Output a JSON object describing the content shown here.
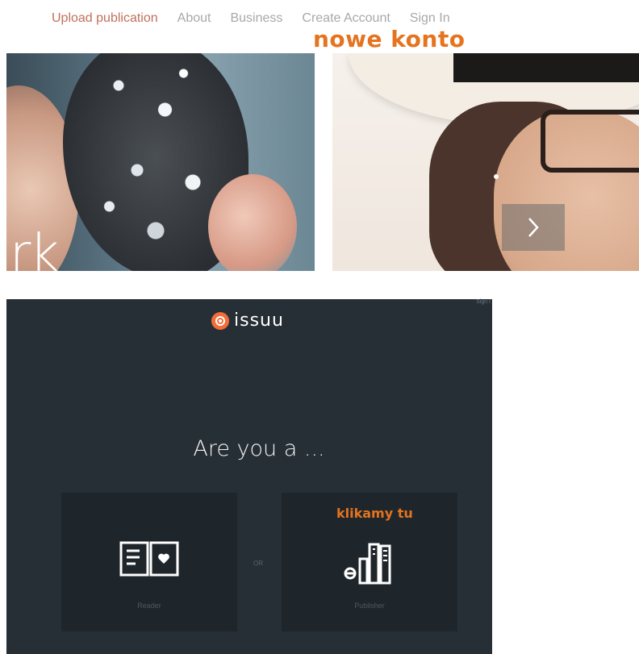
{
  "nav": {
    "items": [
      {
        "label": "Upload publication",
        "active": true
      },
      {
        "label": "About",
        "active": false
      },
      {
        "label": "Business",
        "active": false
      },
      {
        "label": "Create Account",
        "active": false
      },
      {
        "label": "Sign In",
        "active": false
      }
    ]
  },
  "annotations": {
    "new_account": "nowe konto",
    "click_here": "klikamy tu"
  },
  "hero": {
    "left_text": "rk",
    "next_icon": "chevron-right-icon"
  },
  "signup": {
    "corner_text": "Sign I",
    "brand": "issuu",
    "question": "Are you a ...",
    "or_label": "OR",
    "reader_label": "Reader",
    "publisher_label": "Publisher",
    "reader_icon": "open-book-icon",
    "publisher_icon": "publications-icon"
  },
  "colors": {
    "accent_orange": "#e5731f",
    "nav_active": "#c0705a",
    "panel_bg": "#262f35",
    "brand_orange": "#f36d3a"
  }
}
